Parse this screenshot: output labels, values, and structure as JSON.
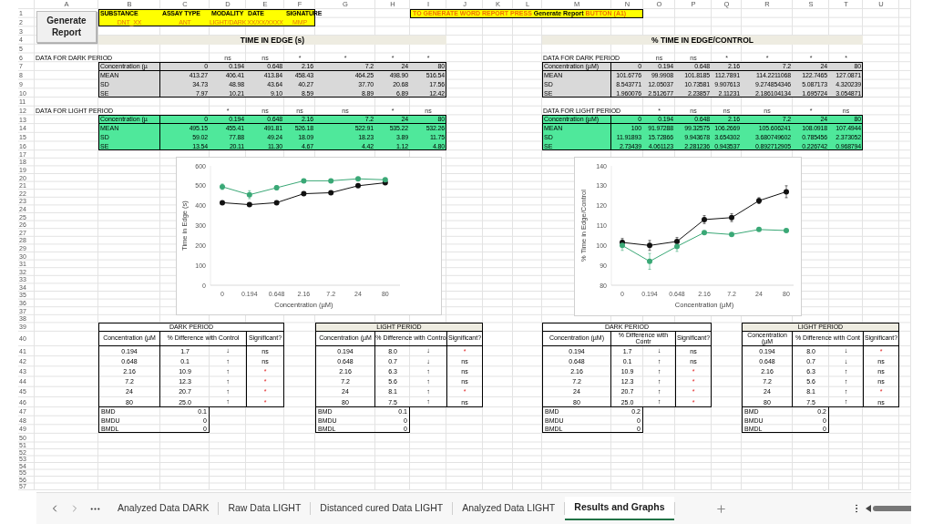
{
  "column_headers": [
    "A",
    "B",
    "C",
    "D",
    "E",
    "F",
    "G",
    "H",
    "I",
    "J",
    "K",
    "L",
    "M",
    "N",
    "O",
    "P",
    "Q",
    "R",
    "S",
    "T",
    "U"
  ],
  "row_numbers": [
    "1",
    "2",
    "3",
    "4",
    "5",
    "6",
    "7",
    "8",
    "9",
    "10",
    "11",
    "12",
    "13",
    "14",
    "15",
    "16",
    "17",
    "18",
    "19",
    "20",
    "21",
    "22",
    "23",
    "24",
    "25",
    "26",
    "27",
    "28",
    "29",
    "30",
    "31",
    "32",
    "33",
    "34",
    "35",
    "36",
    "37",
    "38",
    "39",
    "40",
    "41",
    "42",
    "43",
    "44",
    "45",
    "46",
    "47",
    "48",
    "49",
    "50",
    "51",
    "52",
    "53",
    "54",
    "55",
    "56",
    "57"
  ],
  "generate_button": {
    "label": "Generate Report"
  },
  "info_box": {
    "labels": [
      "SUBSTANCE",
      "ASSAY TYPE",
      "MODALITY",
      "DATE",
      "SIGNATURE"
    ],
    "values": [
      "DNT_XX",
      "ANT",
      "LIGHT/DARK",
      "XX/XX/XXXX",
      "MMP"
    ]
  },
  "instruction": "TO GENERATE WORD REPORT PRESS **Generate Report** BUTTON (A1)",
  "sections": [
    {
      "title": "TIME IN EDGE (s)",
      "blocks": [
        {
          "kind": "dark",
          "label": "DATA FOR DARK PERIOD",
          "significance": [
            "ns",
            "ns",
            "*",
            "*",
            "*",
            "*"
          ],
          "rows": [
            {
              "label": "Concentration (µ",
              "values": [
                "0",
                "0.194",
                "0.648",
                "2.16",
                "7.2",
                "24",
                "80"
              ]
            },
            {
              "label": "MEAN",
              "values": [
                "413.27",
                "406.41",
                "413.84",
                "458.43",
                "464.25",
                "498.90",
                "516.54"
              ]
            },
            {
              "label": "SD",
              "values": [
                "34.73",
                "48.98",
                "43.64",
                "40.27",
                "37.70",
                "20.68",
                "17.56"
              ]
            },
            {
              "label": "SE",
              "values": [
                "7.97",
                "10.21",
                "9.10",
                "8.59",
                "8.89",
                "6.89",
                "12.42"
              ]
            }
          ]
        },
        {
          "kind": "light",
          "label": "DATA FOR LIGHT PERIOD",
          "significance": [
            "*",
            "ns",
            "ns",
            "ns",
            "*",
            "ns"
          ],
          "rows": [
            {
              "label": "Concentration (µ",
              "values": [
                "0",
                "0.194",
                "0.648",
                "2.16",
                "7.2",
                "24",
                "80"
              ]
            },
            {
              "label": "MEAN",
              "values": [
                "495.15",
                "455.41",
                "491.81",
                "526.18",
                "522.91",
                "535.22",
                "532.26"
              ]
            },
            {
              "label": "SD",
              "values": [
                "59.02",
                "77.88",
                "49.24",
                "18.09",
                "18.23",
                "3.89",
                "11.75"
              ]
            },
            {
              "label": "SE",
              "values": [
                "13.54",
                "20.11",
                "11.30",
                "4.67",
                "4.42",
                "1.12",
                "4.80"
              ]
            }
          ]
        }
      ],
      "chart_data": {
        "type": "line",
        "xlabel": "Concentration (µM)",
        "ylabel": "Time in Edge  (s)",
        "categories": [
          "0",
          "0.194",
          "0.648",
          "2.16",
          "7.2",
          "24",
          "80"
        ],
        "ylim": [
          0,
          600
        ],
        "yticks": [
          0,
          100,
          200,
          300,
          400,
          500,
          600
        ],
        "series": [
          {
            "color": "#111111",
            "marker": "circle",
            "values": [
              415,
              405,
              415,
              460,
              465,
              500,
              515
            ]
          },
          {
            "color": "#3aa876",
            "marker": "circle",
            "values": [
              495,
              455,
              490,
              525,
              525,
              535,
              530
            ],
            "errors": [
              14,
              20,
              11,
              null,
              null,
              null,
              null
            ]
          }
        ]
      }
    },
    {
      "title": "% TIME IN EDGE/CONTROL",
      "blocks": [
        {
          "kind": "dark",
          "label": "DATA FOR DARK PERIOD",
          "significance": [
            "ns",
            "ns",
            "*",
            "*",
            "*",
            "*"
          ],
          "rows": [
            {
              "label": "Concentration (µM)",
              "values": [
                "0",
                "0.194",
                "0.648",
                "2.16",
                "7.2",
                "24",
                "80"
              ]
            },
            {
              "label": "MEAN",
              "values": [
                "101.6776",
                "99.9908",
                "101.8185",
                "112.7891",
                "114.2211068",
                "122.7465",
                "127.0871"
              ]
            },
            {
              "label": "SD",
              "values": [
                "8.543771",
                "12.05037",
                "10.73581",
                "9.907613",
                "9.274854346",
                "5.087173",
                "4.320239"
              ]
            },
            {
              "label": "SE",
              "values": [
                "1.960076",
                "2.512677",
                "2.23857",
                "2.11231",
                "2.186104134",
                "1.695724",
                "3.054871"
              ]
            }
          ]
        },
        {
          "kind": "light",
          "label": "DATA FOR LIGHT PERIOD",
          "significance": [
            "*",
            "ns",
            "ns",
            "ns",
            "*",
            "ns"
          ],
          "rows": [
            {
              "label": "Concentration (µM)",
              "values": [
                "0",
                "0.194",
                "0.648",
                "2.16",
                "7.2",
                "24",
                "80"
              ]
            },
            {
              "label": "MEAN",
              "values": [
                "100",
                "91.97288",
                "99.32575",
                "106.2669",
                "105.606241",
                "108.0918",
                "107.4944"
              ]
            },
            {
              "label": "SD",
              "values": [
                "11.91893",
                "15.72866",
                "9.943678",
                "3.654302",
                "3.680749602",
                "0.785456",
                "2.373052"
              ]
            },
            {
              "label": "SE",
              "values": [
                "2.73439",
                "4.061123",
                "2.281236",
                "0.943537",
                "0.892712905",
                "0.226742",
                "0.968794"
              ]
            }
          ]
        }
      ],
      "chart_data": {
        "type": "line",
        "xlabel": "Concentration (µM)",
        "ylabel": "% Time in Edge/Control",
        "categories": [
          "0",
          "0.194",
          "0.648",
          "2.16",
          "7.2",
          "24",
          "80"
        ],
        "ylim": [
          80,
          140
        ],
        "yticks": [
          80,
          90,
          100,
          110,
          120,
          130,
          140
        ],
        "series": [
          {
            "color": "#111111",
            "marker": "circle",
            "values": [
              101.5,
              100,
              102,
              113,
              114,
              122.5,
              127
            ],
            "errors": [
              2,
              2.5,
              2,
              2,
              2,
              1.5,
              3
            ]
          },
          {
            "color": "#3aa876",
            "marker": "circle",
            "values": [
              100,
              92,
              99.5,
              106.5,
              105.5,
              108,
              107.5
            ],
            "errors": [
              2.5,
              4,
              2.5,
              null,
              null,
              null,
              null
            ]
          }
        ]
      }
    }
  ],
  "summary_tables": [
    {
      "kind": "dark",
      "title": "DARK PERIOD",
      "headers": [
        "Concentration (µM",
        "% Difference with Control",
        "Significant?"
      ],
      "rows": [
        {
          "concentration": "0.194",
          "difference": "1.7",
          "arrow": "↓",
          "significance": "ns",
          "significant": false
        },
        {
          "concentration": "0.648",
          "difference": "0.1",
          "arrow": "↑",
          "significance": "ns",
          "significant": false
        },
        {
          "concentration": "2.16",
          "difference": "10.9",
          "arrow": "↑",
          "significance": "*",
          "significant": true
        },
        {
          "concentration": "7.2",
          "difference": "12.3",
          "arrow": "↑",
          "significance": "*",
          "significant": true
        },
        {
          "concentration": "24",
          "difference": "20.7",
          "arrow": "↑",
          "significance": "*",
          "significant": true
        },
        {
          "concentration": "80",
          "difference": "25.0",
          "arrow": "↑",
          "significance": "*",
          "significant": true
        }
      ],
      "bmd": [
        {
          "label": "BMD",
          "value": "0.1"
        },
        {
          "label": "BMDU",
          "value": "0"
        },
        {
          "label": "BMDL",
          "value": "0"
        }
      ]
    },
    {
      "kind": "light",
      "title": "LIGHT PERIOD",
      "headers": [
        "Concentration (µM",
        "% Difference with Contro",
        "Significant?"
      ],
      "rows": [
        {
          "concentration": "0.194",
          "difference": "8.0",
          "arrow": "↓",
          "significance": "*",
          "significant": true
        },
        {
          "concentration": "0.648",
          "difference": "0.7",
          "arrow": "↓",
          "significance": "ns",
          "significant": false
        },
        {
          "concentration": "2.16",
          "difference": "6.3",
          "arrow": "↑",
          "significance": "ns",
          "significant": false
        },
        {
          "concentration": "7.2",
          "difference": "5.6",
          "arrow": "↑",
          "significance": "ns",
          "significant": false
        },
        {
          "concentration": "24",
          "difference": "8.1",
          "arrow": "↑",
          "significance": "*",
          "significant": true
        },
        {
          "concentration": "80",
          "difference": "7.5",
          "arrow": "↑",
          "significance": "ns",
          "significant": false
        }
      ],
      "bmd": [
        {
          "label": "BMD",
          "value": "0.1"
        },
        {
          "label": "BMDU",
          "value": "0"
        },
        {
          "label": "BMDL",
          "value": "0"
        }
      ]
    },
    {
      "kind": "dark",
      "title": "DARK PERIOD",
      "headers": [
        "Concentration (µM)",
        "% Difference with Contr",
        "Significant?"
      ],
      "rows": [
        {
          "concentration": "0.194",
          "difference": "1.7",
          "arrow": "↓",
          "significance": "ns",
          "significant": false
        },
        {
          "concentration": "0.648",
          "difference": "0.1",
          "arrow": "↑",
          "significance": "ns",
          "significant": false
        },
        {
          "concentration": "2.16",
          "difference": "10.9",
          "arrow": "↑",
          "significance": "*",
          "significant": true
        },
        {
          "concentration": "7.2",
          "difference": "12.3",
          "arrow": "↑",
          "significance": "*",
          "significant": true
        },
        {
          "concentration": "24",
          "difference": "20.7",
          "arrow": "↑",
          "significance": "*",
          "significant": true
        },
        {
          "concentration": "80",
          "difference": "25.0",
          "arrow": "↑",
          "significance": "*",
          "significant": true
        }
      ],
      "bmd": [
        {
          "label": "BMD",
          "value": "0.2"
        },
        {
          "label": "BMDU",
          "value": "0"
        },
        {
          "label": "BMDL",
          "value": "0"
        }
      ]
    },
    {
      "kind": "light",
      "title": "LIGHT PERIOD",
      "headers": [
        "Concentration (µM",
        "% Difference with Cont",
        "Significant?"
      ],
      "rows": [
        {
          "concentration": "0.194",
          "difference": "8.0",
          "arrow": "↓",
          "significance": "*",
          "significant": true
        },
        {
          "concentration": "0.648",
          "difference": "0.7",
          "arrow": "↓",
          "significance": "ns",
          "significant": false
        },
        {
          "concentration": "2.16",
          "difference": "6.3",
          "arrow": "↑",
          "significance": "ns",
          "significant": false
        },
        {
          "concentration": "7.2",
          "difference": "5.6",
          "arrow": "↑",
          "significance": "ns",
          "significant": false
        },
        {
          "concentration": "24",
          "difference": "8.1",
          "arrow": "↑",
          "significance": "*",
          "significant": true
        },
        {
          "concentration": "80",
          "difference": "7.5",
          "arrow": "↑",
          "significance": "ns",
          "significant": false
        }
      ],
      "bmd": [
        {
          "label": "BMD",
          "value": "0.2"
        },
        {
          "label": "BMDU",
          "value": "0"
        },
        {
          "label": "BMDL",
          "value": "0"
        }
      ]
    }
  ],
  "sheet_tabs": [
    {
      "label": "Analyzed Data DARK",
      "selected": false
    },
    {
      "label": "Raw Data LIGHT",
      "selected": false
    },
    {
      "label": "Distanced cured Data LIGHT",
      "selected": false
    },
    {
      "label": "Analyzed Data LIGHT",
      "selected": false
    },
    {
      "label": "Results and Graphs",
      "selected": true
    }
  ]
}
